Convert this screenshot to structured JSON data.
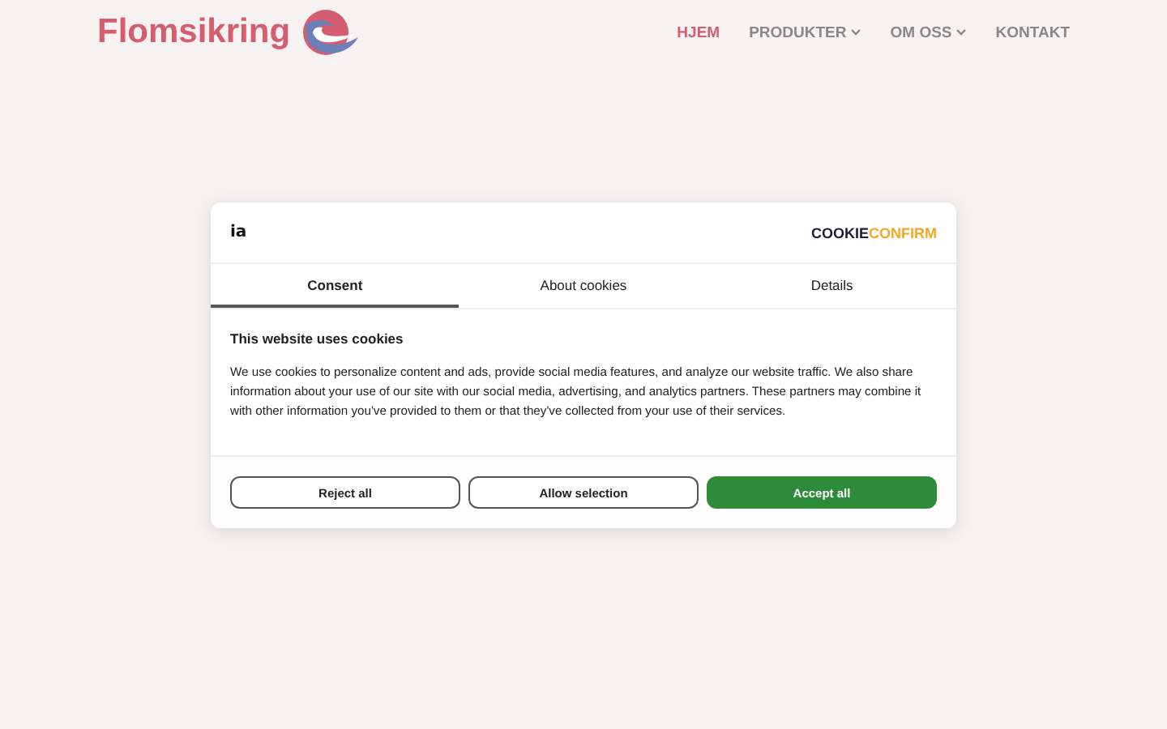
{
  "site": {
    "name": "Flomsikring"
  },
  "nav": [
    {
      "label": "HJEM",
      "selected": true,
      "dropdown": false
    },
    {
      "label": "PRODUKTER",
      "selected": false,
      "dropdown": true
    },
    {
      "label": "OM OSS",
      "selected": false,
      "dropdown": true
    },
    {
      "label": "KONTAKT",
      "selected": false,
      "dropdown": false
    }
  ],
  "dialog": {
    "brand_logo": "ia",
    "provider_logo": {
      "part_1": "COOKIE",
      "part_2": "CONFIRM"
    },
    "tabs": [
      {
        "label": "Consent",
        "selected": true
      },
      {
        "label": "About cookies",
        "selected": false
      },
      {
        "label": "Details",
        "selected": false
      }
    ],
    "heading": "This website uses cookies",
    "body": "We use cookies to personalize content and ads, provide social media features, and analyze our website traffic. We also share information about your use of our site with our social media, advertising, and analytics partners. These partners may combine it with other information you've provided to them or that they've collected from your use of their services.",
    "buttons": [
      {
        "label": "Reject all",
        "kind": "outline"
      },
      {
        "label": "Allow selection",
        "kind": "outline"
      },
      {
        "label": "Accept all",
        "kind": "primary"
      }
    ]
  }
}
